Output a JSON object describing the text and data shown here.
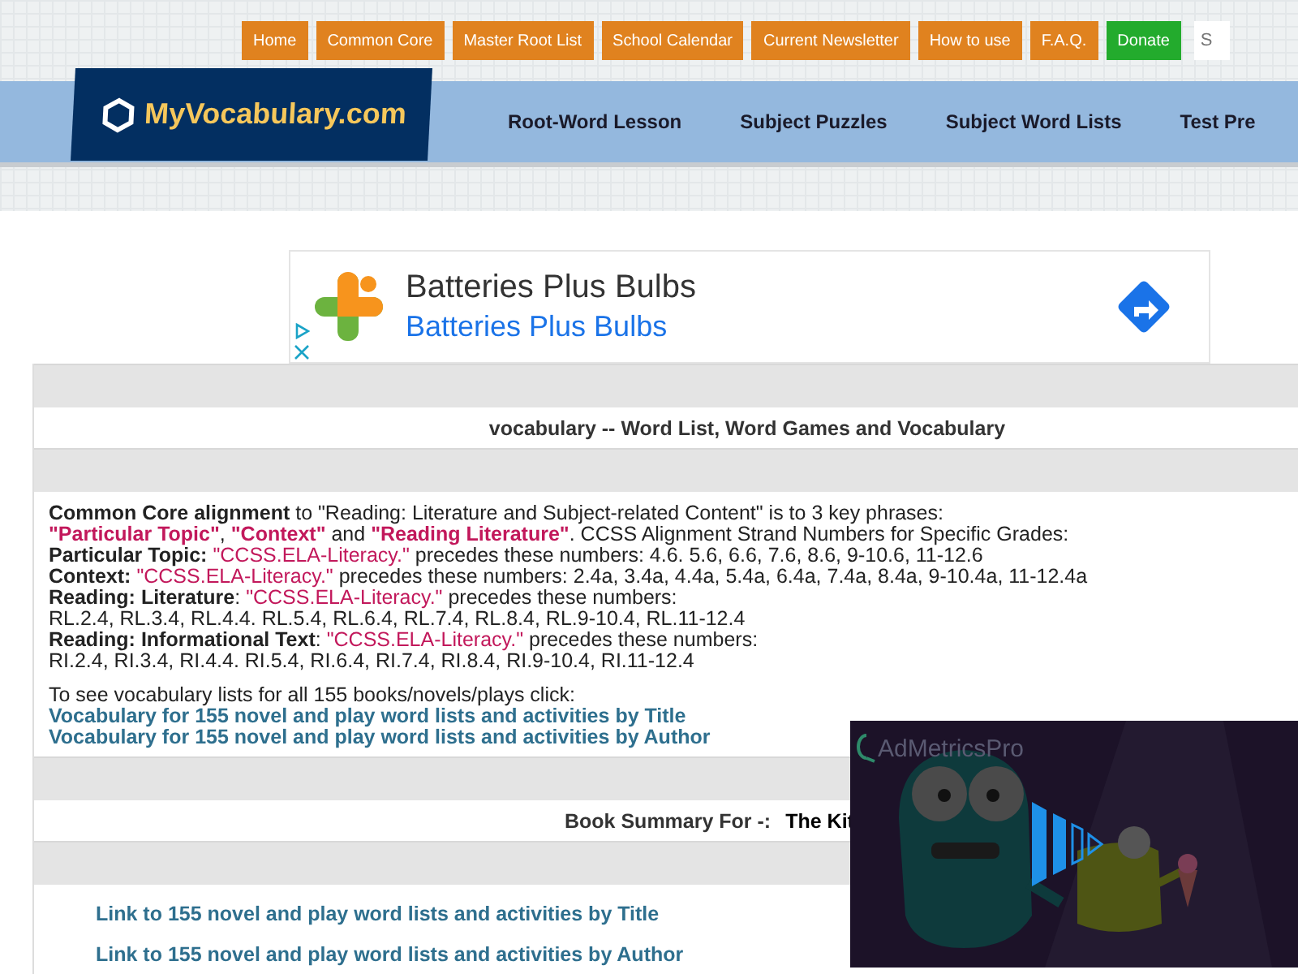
{
  "top_buttons": [
    {
      "label": "Home",
      "kind": "nav"
    },
    {
      "label": "Common Core",
      "kind": "nav"
    },
    {
      "label": "Master Root List",
      "kind": "nav"
    },
    {
      "label": "School Calendar",
      "kind": "nav"
    },
    {
      "label": "Current Newsletter",
      "kind": "nav"
    },
    {
      "label": "How to use",
      "kind": "nav"
    },
    {
      "label": "F.A.Q.",
      "kind": "nav"
    },
    {
      "label": "Donate",
      "kind": "donate"
    }
  ],
  "search": {
    "placeholder": "S"
  },
  "logo": "MyVocabulary.com",
  "nav": [
    "Root-Word Lesson",
    "Subject Puzzles",
    "Subject Word Lists",
    "Test Pre"
  ],
  "ad": {
    "title": "Batteries Plus Bulbs",
    "subtitle": "Batteries Plus Bulbs"
  },
  "page_title": "vocabulary -- Word List, Word Games and Vocabulary",
  "alignment_lines": [
    "**Common Core alignment** to \"Reading: Literature and Subject-related Content\" is to 3 key phrases:",
    "**\"Particular Topic\"**, **\"Context\"** and **\"Reading Literature\"**. CCSS Alignment Strand Numbers for Specific Grades:",
    "**Particular Topic:** \"CCSS.ELA-Literacy.\" precedes these numbers: 4.6. 5.6, 6.6, 7.6, 8.6, 9-10.6, 11-12.6",
    "**Context:** \"CCSS.ELA-Literacy.\" precedes these numbers: 2.4a, 3.4a, 4.4a, 5.4a, 6.4a, 7.4a, 8.4a, 9-10.4a, 11-12.4a",
    "**Reading: Literature**: \"CCSS.ELA-Literacy.\" precedes these numbers:",
    "RL.2.4, RL.3.4, RL.4.4. RL.5.4, RL.6.4, RL.7.4, RL.8.4, RL.9-10.4, RL.11-12.4",
    "**Reading: Informational Text**: \"CCSS.ELA-Literacy.\" precedes these numbers:",
    "RI.2.4, RI.3.4, RI.4.4. RI.5.4, RI.6.4, RI.7.4, RI.8.4, RI.9-10.4, RI.11-12.4"
  ],
  "lists_intro": "To see vocabulary lists for all 155 books/novels/plays click:",
  "lists_links": [
    "Vocabulary for 155 novel and play word lists and activities by Title",
    "Vocabulary for 155 novel and play word lists and activities by Author"
  ],
  "summary_label": "Book Summary For -:",
  "summary_title": "The Kit",
  "bottom_links": [
    "Link to 155 novel and play word lists and activities by Title",
    "Link to 155 novel and play word lists and activities by Author"
  ],
  "video_ad": {
    "brand": "AdMetricsPro"
  }
}
